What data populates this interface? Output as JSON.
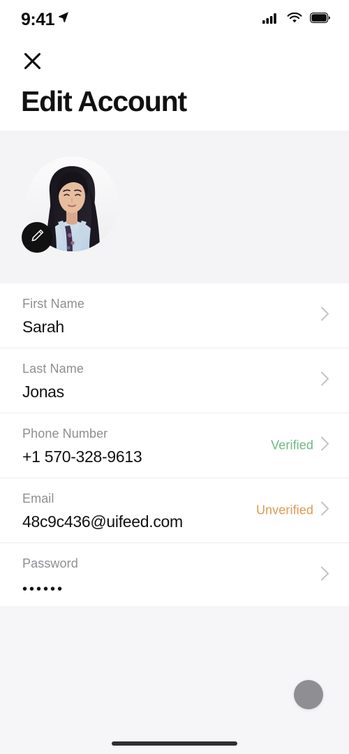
{
  "status_bar": {
    "time": "9:41",
    "location_icon": "location-arrow-icon",
    "signal_icon": "cellular-signal-icon",
    "wifi_icon": "wifi-icon",
    "battery_icon": "battery-full-icon"
  },
  "header": {
    "close_icon": "close-icon",
    "title": "Edit Account"
  },
  "avatar": {
    "alt": "profile-photo",
    "edit_icon": "pencil-icon"
  },
  "form": {
    "rows": [
      {
        "label": "First Name",
        "value": "Sarah",
        "status": "",
        "status_color": "",
        "chevron": "chevron-right-icon",
        "masked": false
      },
      {
        "label": "Last Name",
        "value": "Jonas",
        "status": "",
        "status_color": "",
        "chevron": "chevron-right-icon",
        "masked": false
      },
      {
        "label": "Phone Number",
        "value": "+1 570-328-9613",
        "status": "Verified",
        "status_color": "#6fb882",
        "chevron": "chevron-right-icon",
        "masked": false
      },
      {
        "label": "Email",
        "value": "48c9c436@uifeed.com",
        "status": "Unverified",
        "status_color": "#e09a4e",
        "chevron": "chevron-right-icon",
        "masked": false
      },
      {
        "label": "Password",
        "value": "••••••",
        "status": "",
        "status_color": "",
        "chevron": "chevron-right-icon",
        "masked": true
      }
    ]
  },
  "bottom": {
    "fab_name": "floating-action-button",
    "fab_color": "#8e8e93",
    "home_indicator": "home-indicator"
  },
  "colors": {
    "background": "#ffffff",
    "section_background": "#f4f4f6",
    "bottom_background": "#f6f5f7",
    "label": "#8e8e93",
    "value": "#111111",
    "divider": "#ececee",
    "verified": "#6fb882",
    "unverified": "#e09a4e"
  }
}
